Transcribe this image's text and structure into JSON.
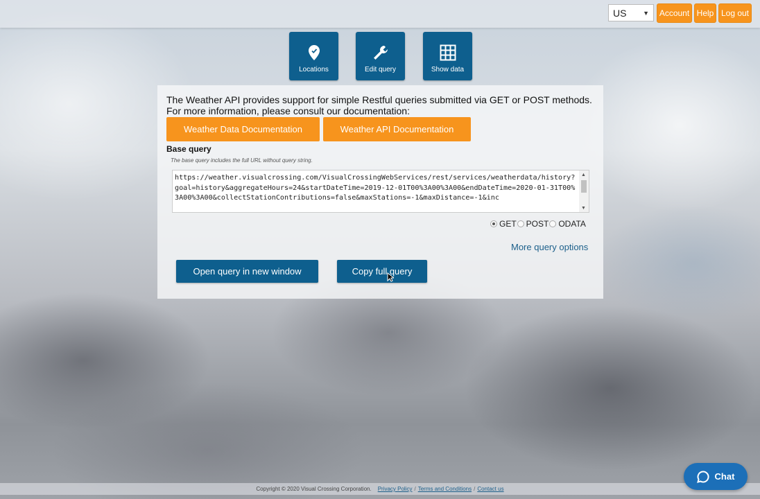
{
  "header": {
    "region": "US",
    "account_label": "Account",
    "help_label": "Help",
    "logout_label": "Log out"
  },
  "nav": {
    "tiles": [
      {
        "label": "Locations",
        "icon": "map-pin-icon"
      },
      {
        "label": "Edit query",
        "icon": "wrench-icon"
      },
      {
        "label": "Show data",
        "icon": "grid-icon"
      }
    ]
  },
  "intro": {
    "line1": "The Weather API provides support for simple Restful queries submitted via GET or POST methods.",
    "line2": "For more information, please consult our documentation:"
  },
  "docs": {
    "data_doc_label": "Weather Data Documentation",
    "api_doc_label": "Weather API Documentation"
  },
  "base_query": {
    "label": "Base query",
    "help": "The base query includes the full URL without query string.",
    "value": "https://weather.visualcrossing.com/VisualCrossingWebServices/rest/services/weatherdata/history?goal=history&aggregateHours=24&startDateTime=2019-12-01T00%3A00%3A00&endDateTime=2020-01-31T00%3A00%3A00&collectStationContributions=false&maxStations=-1&maxDistance=-1&inc"
  },
  "methods": {
    "options": [
      "GET",
      "POST",
      "ODATA"
    ],
    "selected": "GET"
  },
  "more_options_label": "More query options",
  "actions": {
    "open_label": "Open query in new window",
    "copy_label": "Copy full query"
  },
  "footer": {
    "copyright": "Copyright © 2020 Visual Crossing Corporation.",
    "privacy": "Privacy Policy",
    "terms": "Terms and Conditions",
    "contact": "Contact us"
  },
  "chat_label": "Chat",
  "colors": {
    "accent_orange": "#f7941d",
    "primary_blue": "#0e5f8e",
    "chat_blue": "#1c6fb8",
    "link_blue": "#1c5f8a"
  }
}
